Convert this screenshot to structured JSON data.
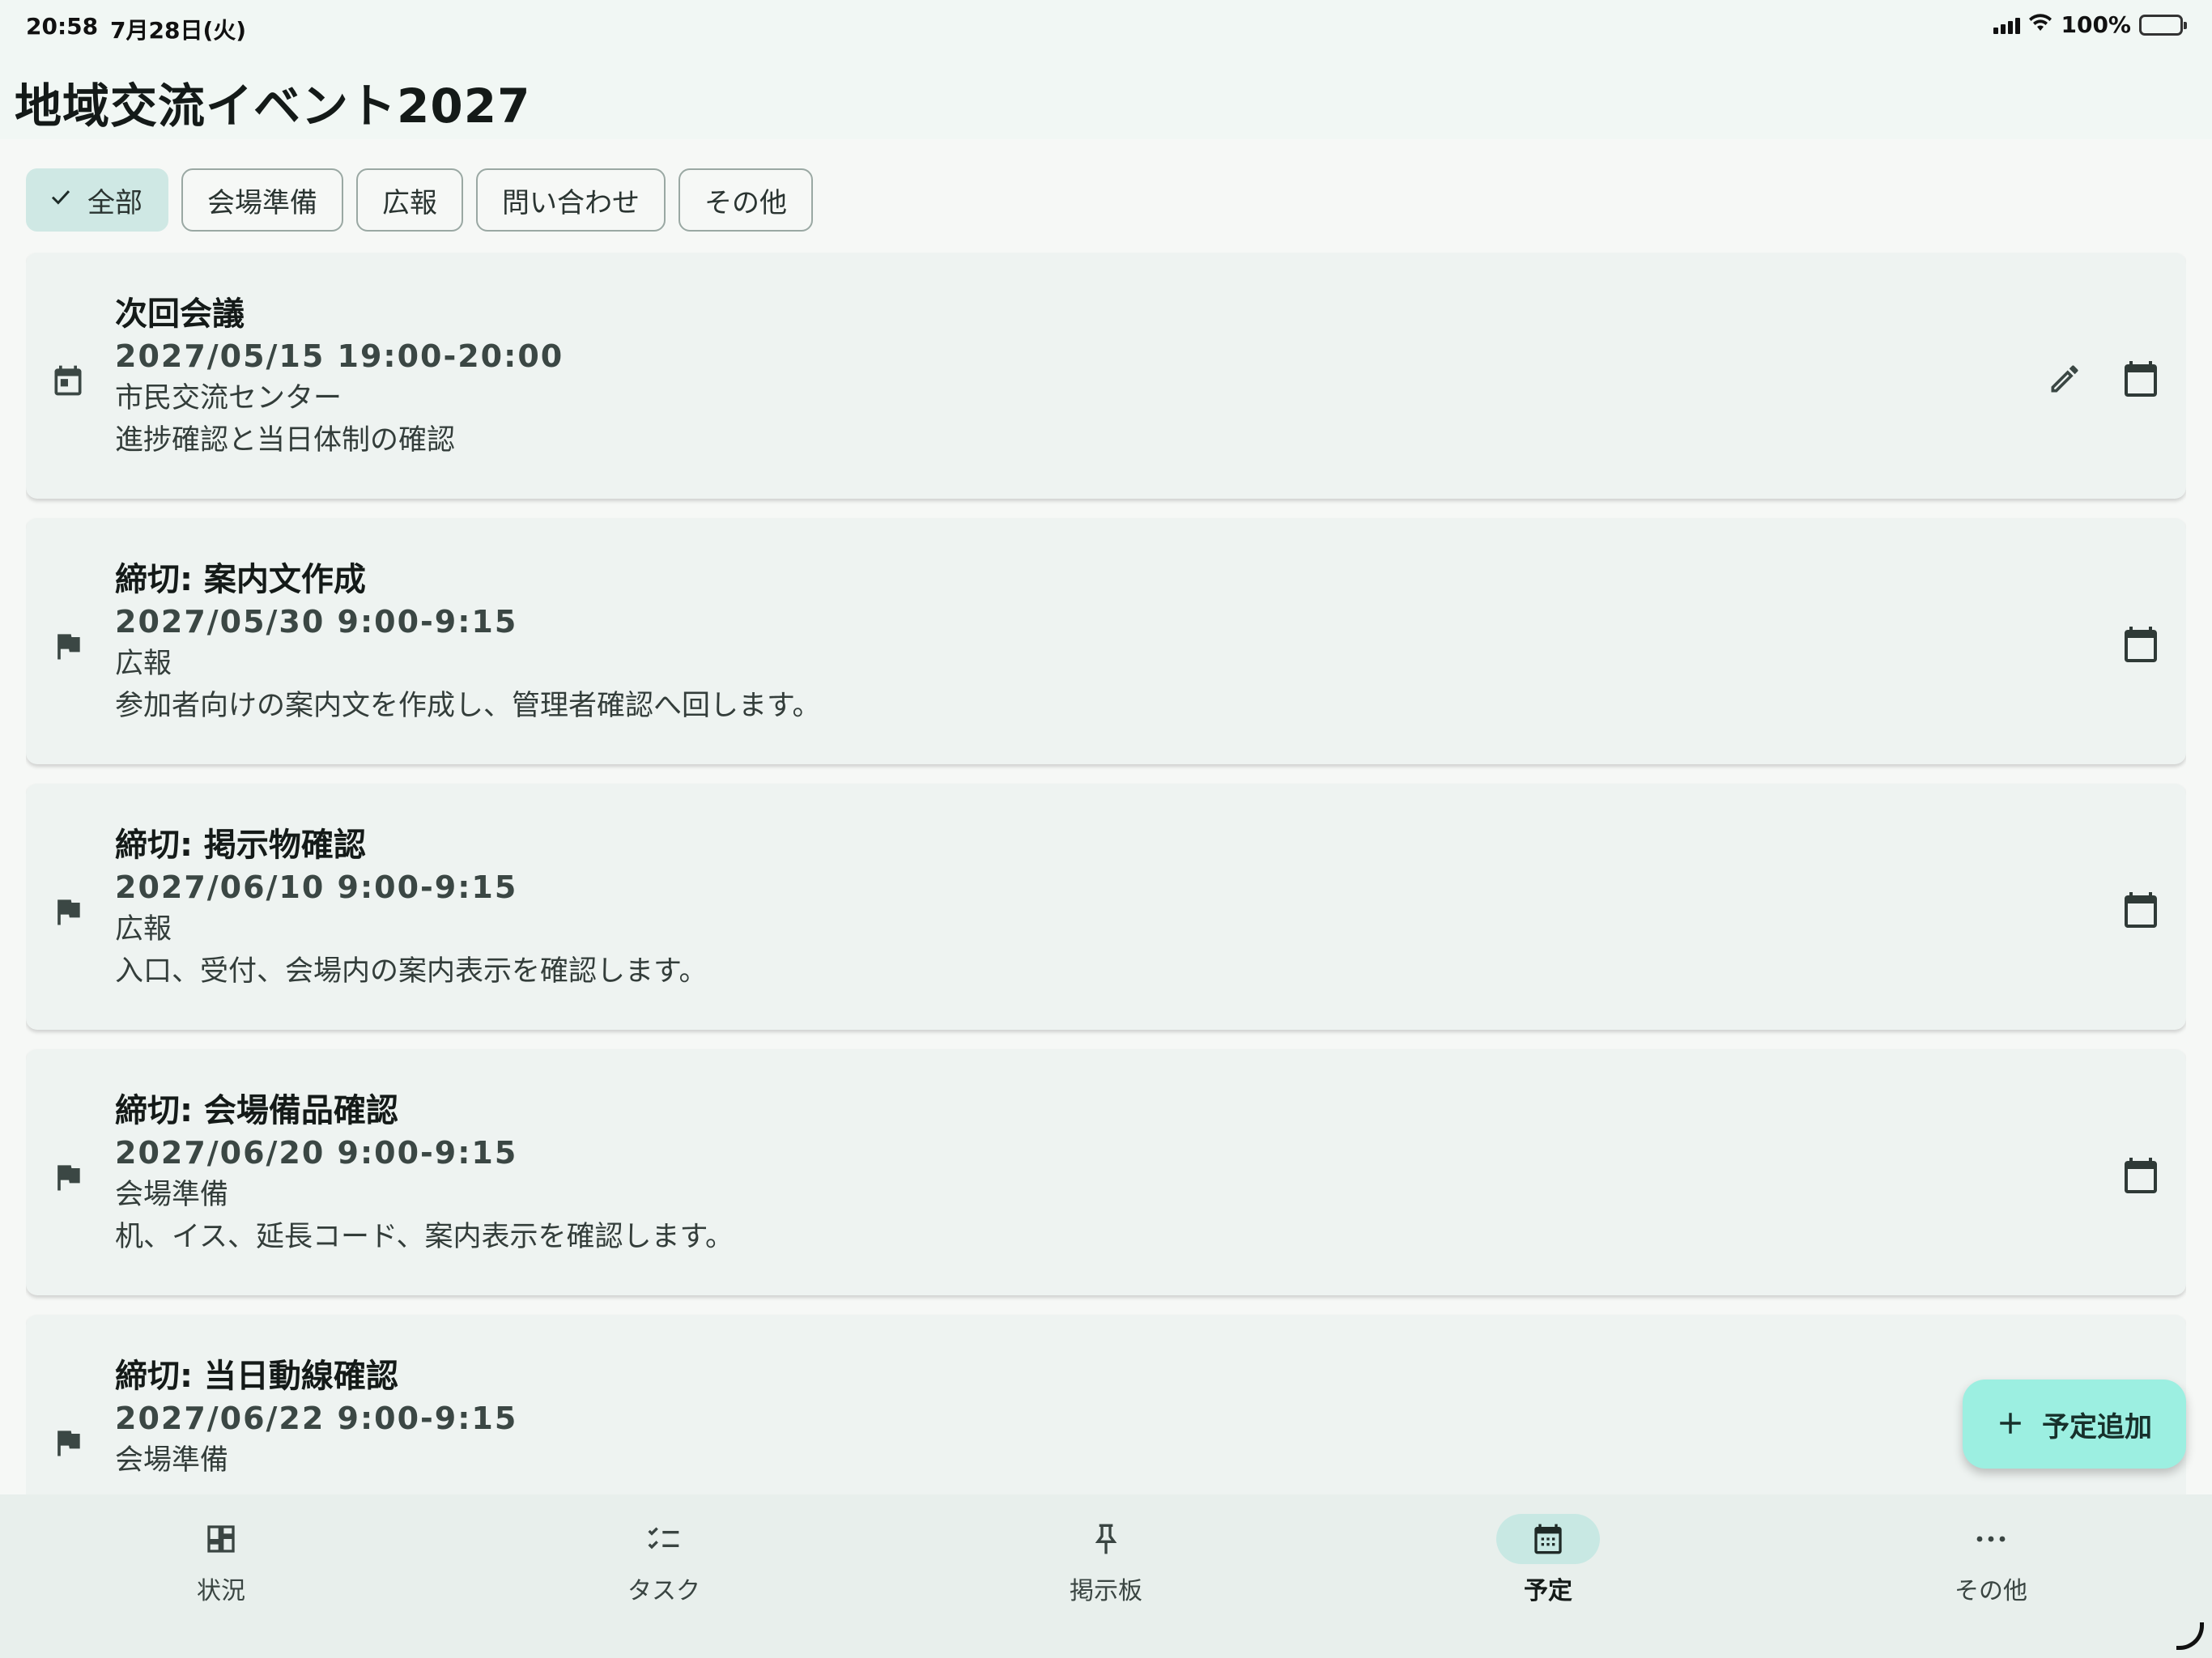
{
  "status_bar": {
    "time": "20:58",
    "date": "7月28日(火)",
    "battery": "100%"
  },
  "app": {
    "title": "地域交流イベント2027"
  },
  "filters": [
    {
      "label": "全部",
      "selected": true
    },
    {
      "label": "会場準備",
      "selected": false
    },
    {
      "label": "広報",
      "selected": false
    },
    {
      "label": "問い合わせ",
      "selected": false
    },
    {
      "label": "その他",
      "selected": false
    }
  ],
  "events": [
    {
      "icon": "event-icon",
      "title": "次回会議",
      "datetime": "2027/05/15 19:00-20:00",
      "place": "市民交流センター",
      "desc": "進捗確認と当日体制の確認",
      "editable": true
    },
    {
      "icon": "flag-icon",
      "title": "締切: 案内文作成",
      "datetime": "2027/05/30 9:00-9:15",
      "place": "広報",
      "desc": "参加者向けの案内文を作成し、管理者確認へ回します。",
      "editable": false
    },
    {
      "icon": "flag-icon",
      "title": "締切: 掲示物確認",
      "datetime": "2027/06/10 9:00-9:15",
      "place": "広報",
      "desc": "入口、受付、会場内の案内表示を確認します。",
      "editable": false
    },
    {
      "icon": "flag-icon",
      "title": "締切: 会場備品確認",
      "datetime": "2027/06/20 9:00-9:15",
      "place": "会場準備",
      "desc": "机、イス、延長コード、案内表示を確認します。",
      "editable": false
    },
    {
      "icon": "flag-icon",
      "title": "締切: 当日動線確認",
      "datetime": "2027/06/22 9:00-9:15",
      "place": "会場準備",
      "desc": "",
      "editable": false
    }
  ],
  "fab": {
    "label": "予定追加"
  },
  "bottom_nav": [
    {
      "label": "状況",
      "icon": "dashboard-icon",
      "active": false
    },
    {
      "label": "タスク",
      "icon": "checklist-icon",
      "active": false
    },
    {
      "label": "掲示板",
      "icon": "pin-icon",
      "active": false
    },
    {
      "label": "予定",
      "icon": "calendar-icon",
      "active": true
    },
    {
      "label": "その他",
      "icon": "more-horiz-icon",
      "active": false
    }
  ],
  "colors": {
    "accent": "#9cefe1",
    "chip_selected": "#cfe8e4",
    "nav_active": "#c8e8e3"
  }
}
